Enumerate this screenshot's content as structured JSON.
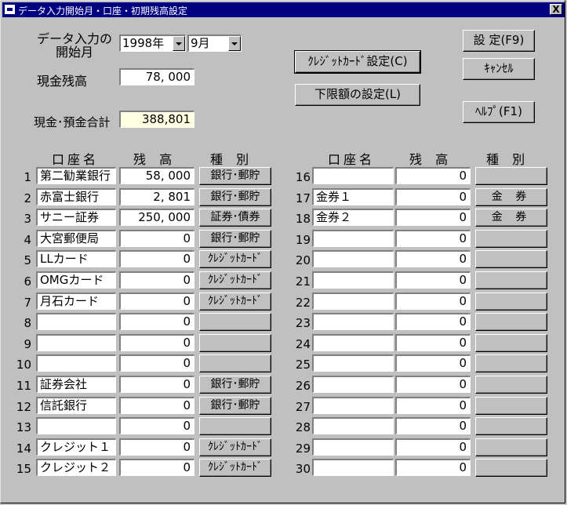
{
  "window": {
    "title": "データ入力開始月・口座・初期残高設定",
    "close_label": "X"
  },
  "start": {
    "label_line1": "データ入力の",
    "label_line2": "開始月",
    "year": "1998年",
    "month": "9月"
  },
  "cash": {
    "label": "現金残高",
    "value": "78, 000"
  },
  "total": {
    "label": "現金･預金合計",
    "value": "388,801"
  },
  "buttons": {
    "credit_setting": "ｸﾚｼﾞｯﾄｶｰﾄﾞ設定(C)",
    "lower_limit": "下限額の設定(L)",
    "ok": "設 定(F9)",
    "cancel": "ｷｬﾝｾﾙ",
    "help": "ﾍﾙﾌﾟ(F1)"
  },
  "headers": {
    "name": "口座名",
    "balance": "残 高",
    "type": "種 別"
  },
  "accounts_left": [
    {
      "no": "1",
      "name": "第二勧業銀行",
      "balance": "58, 000",
      "type": "銀行･郵貯"
    },
    {
      "no": "2",
      "name": "赤富士銀行",
      "balance": "2, 801",
      "type": "銀行･郵貯"
    },
    {
      "no": "3",
      "name": "サニー証券",
      "balance": "250, 000",
      "type": "証券･債券"
    },
    {
      "no": "4",
      "name": "大宮郵便局",
      "balance": "0",
      "type": "銀行･郵貯"
    },
    {
      "no": "5",
      "name": "LLカード",
      "balance": "0",
      "type": "ｸﾚｼﾞｯﾄｶｰﾄﾞ"
    },
    {
      "no": "6",
      "name": "OMGカード",
      "balance": "0",
      "type": "ｸﾚｼﾞｯﾄｶｰﾄﾞ"
    },
    {
      "no": "7",
      "name": "月石カード",
      "balance": "0",
      "type": "ｸﾚｼﾞｯﾄｶｰﾄﾞ"
    },
    {
      "no": "8",
      "name": "",
      "balance": "0",
      "type": ""
    },
    {
      "no": "9",
      "name": "",
      "balance": "0",
      "type": ""
    },
    {
      "no": "10",
      "name": "",
      "balance": "0",
      "type": ""
    },
    {
      "no": "11",
      "name": "証券会社",
      "balance": "0",
      "type": "銀行･郵貯"
    },
    {
      "no": "12",
      "name": "信託銀行",
      "balance": "0",
      "type": "銀行･郵貯"
    },
    {
      "no": "13",
      "name": "",
      "balance": "0",
      "type": ""
    },
    {
      "no": "14",
      "name": "クレジット１",
      "balance": "0",
      "type": "ｸﾚｼﾞｯﾄｶｰﾄﾞ"
    },
    {
      "no": "15",
      "name": "クレジット２",
      "balance": "0",
      "type": "ｸﾚｼﾞｯﾄｶｰﾄﾞ"
    }
  ],
  "accounts_right": [
    {
      "no": "16",
      "name": "",
      "balance": "0",
      "type": ""
    },
    {
      "no": "17",
      "name": "金券１",
      "balance": "0",
      "type": "金 券"
    },
    {
      "no": "18",
      "name": "金券２",
      "balance": "0",
      "type": "金 券"
    },
    {
      "no": "19",
      "name": "",
      "balance": "0",
      "type": ""
    },
    {
      "no": "20",
      "name": "",
      "balance": "0",
      "type": ""
    },
    {
      "no": "21",
      "name": "",
      "balance": "0",
      "type": ""
    },
    {
      "no": "22",
      "name": "",
      "balance": "0",
      "type": ""
    },
    {
      "no": "23",
      "name": "",
      "balance": "0",
      "type": ""
    },
    {
      "no": "24",
      "name": "",
      "balance": "0",
      "type": ""
    },
    {
      "no": "25",
      "name": "",
      "balance": "0",
      "type": ""
    },
    {
      "no": "26",
      "name": "",
      "balance": "0",
      "type": ""
    },
    {
      "no": "27",
      "name": "",
      "balance": "0",
      "type": ""
    },
    {
      "no": "28",
      "name": "",
      "balance": "0",
      "type": ""
    },
    {
      "no": "29",
      "name": "",
      "balance": "0",
      "type": ""
    },
    {
      "no": "30",
      "name": "",
      "balance": "0",
      "type": ""
    }
  ]
}
